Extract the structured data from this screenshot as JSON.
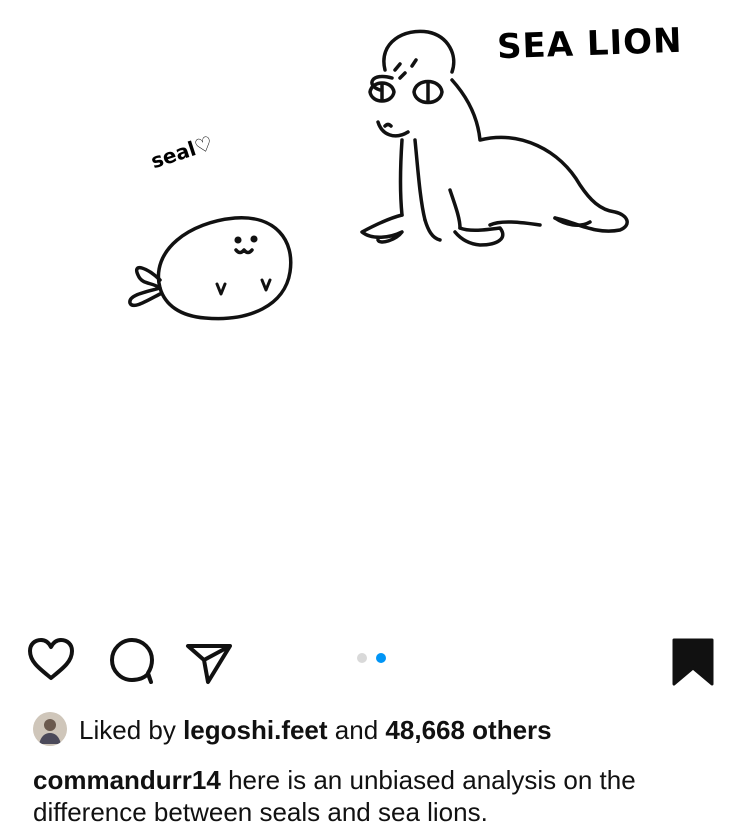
{
  "post": {
    "image": {
      "sealion_label": "SEA LION",
      "seal_label": "seal♡"
    },
    "carousel": {
      "total": 2,
      "active_index": 1,
      "active_color": "#0095f6",
      "inactive_color": "#d9d9d9"
    },
    "likes": {
      "prefix": "Liked by",
      "liker": "legoshi.feet",
      "conjunction": "and",
      "others": "48,668 others"
    },
    "caption": {
      "username": "commandurr14",
      "text": "here is an unbiased analysis on the difference between seals and sea lions."
    },
    "icons": {
      "like": "heart-icon",
      "comment": "comment-bubble-icon",
      "share": "paper-plane-icon",
      "save": "bookmark-icon"
    }
  }
}
